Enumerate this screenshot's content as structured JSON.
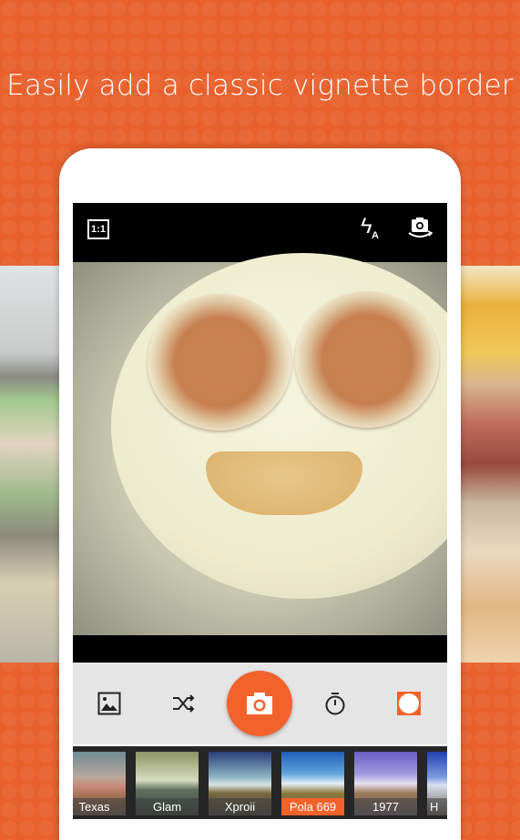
{
  "headline": "Easily add a classic vignette border",
  "camera": {
    "top_bar": {
      "aspect_ratio_label": "1:1",
      "flash_mode_label": "A",
      "icons": [
        "aspect-ratio-icon",
        "flash-auto-icon",
        "switch-camera-icon"
      ]
    },
    "controls": {
      "icons": [
        "gallery-icon",
        "shuffle-icon",
        "camera-shutter-icon",
        "timer-icon",
        "vignette-border-icon"
      ]
    },
    "filters": [
      {
        "label": "Texas",
        "selected": false
      },
      {
        "label": "Glam",
        "selected": false
      },
      {
        "label": "Xproii",
        "selected": false
      },
      {
        "label": "Pola 669",
        "selected": true
      },
      {
        "label": "1977",
        "selected": false
      },
      {
        "label": "H",
        "selected": false
      }
    ]
  },
  "colors": {
    "accent": "#f4622c",
    "background": "#e8602c",
    "control_bar": "#e5e5e5",
    "filter_strip": "#262626"
  }
}
